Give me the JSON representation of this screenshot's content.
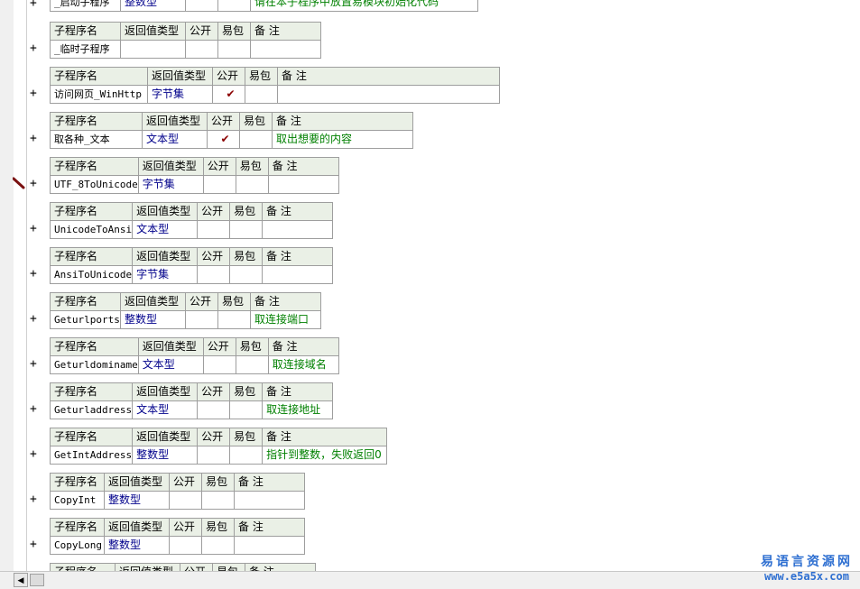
{
  "headers": {
    "name": "子程序名",
    "ret": "返回值类型",
    "pub": "公开",
    "easy": "易包",
    "note": "备 注"
  },
  "top_partial": {
    "name": "_启动子程序",
    "type": "整数型",
    "note": "请在本子程序中放置易模块初始化代码"
  },
  "subs": [
    {
      "name": "_临时子程序",
      "type": "",
      "public": "",
      "note": ""
    },
    {
      "name": "访问网页_WinHttp",
      "type": "字节集",
      "public": "✔",
      "note": ""
    },
    {
      "name": "取各种_文本",
      "type": "文本型",
      "public": "✔",
      "note": "取出想要的内容"
    },
    {
      "name": "UTF_8ToUnicode",
      "type": "字节集",
      "public": "",
      "note": ""
    },
    {
      "name": "UnicodeToAnsi",
      "type": "文本型",
      "public": "",
      "note": ""
    },
    {
      "name": "AnsiToUnicode",
      "type": "字节集",
      "public": "",
      "note": ""
    },
    {
      "name": "Geturlports",
      "type": "整数型",
      "public": "",
      "note": "取连接端口"
    },
    {
      "name": "Geturldominame",
      "type": "文本型",
      "public": "",
      "note": "取连接域名"
    },
    {
      "name": "Geturladdress",
      "type": "文本型",
      "public": "",
      "note": "取连接地址"
    },
    {
      "name": "GetIntAddress",
      "type": "整数型",
      "public": "",
      "note": "指针到整数，失败返回0"
    },
    {
      "name": "CopyInt",
      "type": "整数型",
      "public": "",
      "note": ""
    },
    {
      "name": "CopyLong",
      "type": "整数型",
      "public": "",
      "note": ""
    }
  ],
  "expand_symbol": "+",
  "scrollbar": {
    "left_arrow": "◀"
  },
  "watermark": {
    "title": "易语言资源网",
    "url": "www.e5a5x.com"
  }
}
